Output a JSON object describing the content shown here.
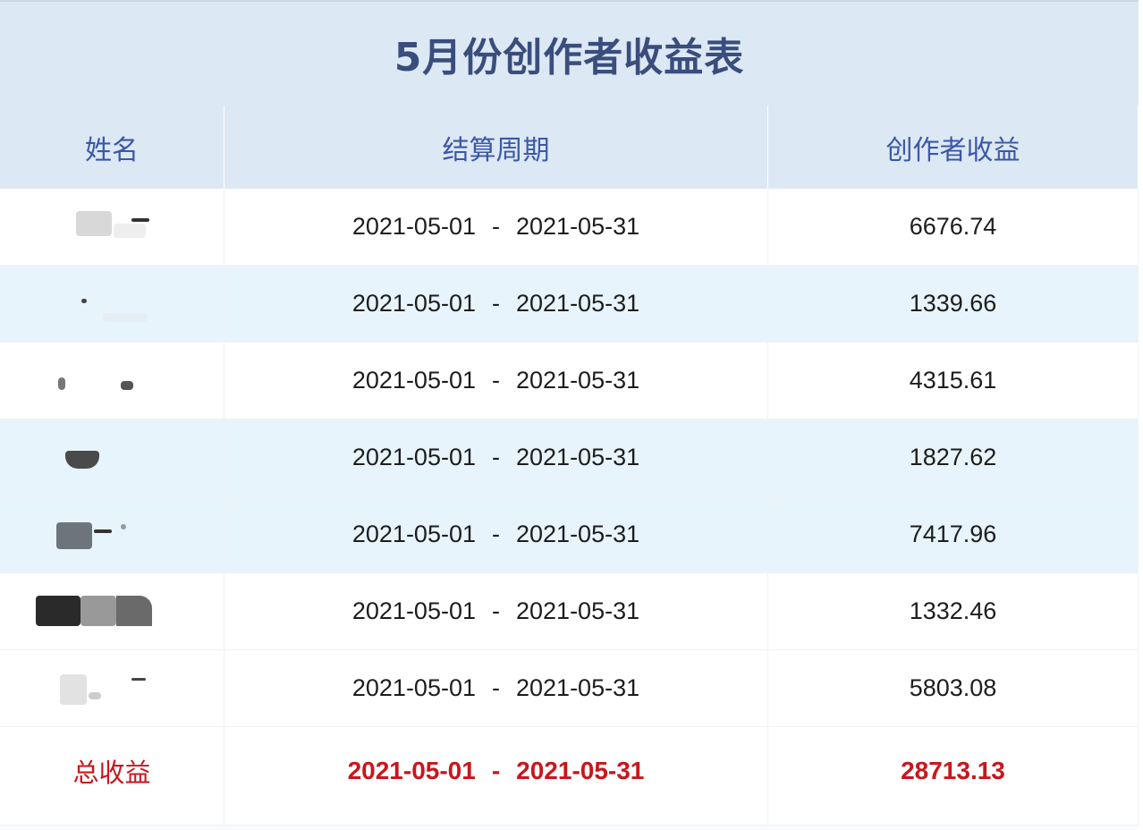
{
  "title": "5月份创作者收益表",
  "columns": {
    "name": "姓名",
    "period": "结算周期",
    "income": "创作者收益"
  },
  "rows": [
    {
      "start": "2021-05-01",
      "sep": "-",
      "end": "2021-05-31",
      "income": "6676.74",
      "bg": "white"
    },
    {
      "start": "2021-05-01",
      "sep": "-",
      "end": "2021-05-31",
      "income": "1339.66",
      "bg": "blue"
    },
    {
      "start": "2021-05-01",
      "sep": "-",
      "end": "2021-05-31",
      "income": "4315.61",
      "bg": "white"
    },
    {
      "start": "2021-05-01",
      "sep": "-",
      "end": "2021-05-31",
      "income": "1827.62",
      "bg": "blue"
    },
    {
      "start": "2021-05-01",
      "sep": "-",
      "end": "2021-05-31",
      "income": "7417.96",
      "bg": "blue"
    },
    {
      "start": "2021-05-01",
      "sep": "-",
      "end": "2021-05-31",
      "income": "1332.46",
      "bg": "white"
    },
    {
      "start": "2021-05-01",
      "sep": "-",
      "end": "2021-05-31",
      "income": "5803.08",
      "bg": "white"
    }
  ],
  "total": {
    "label": "总收益",
    "start": "2021-05-01",
    "sep": "-",
    "end": "2021-05-31",
    "income": "28713.13"
  },
  "colors": {
    "header_bg": "#dde8f5",
    "title_text": "#3a4e7d",
    "header_text": "#3a58a5",
    "stripe_blue": "#e8f4fc",
    "total_red": "#c8161d"
  }
}
